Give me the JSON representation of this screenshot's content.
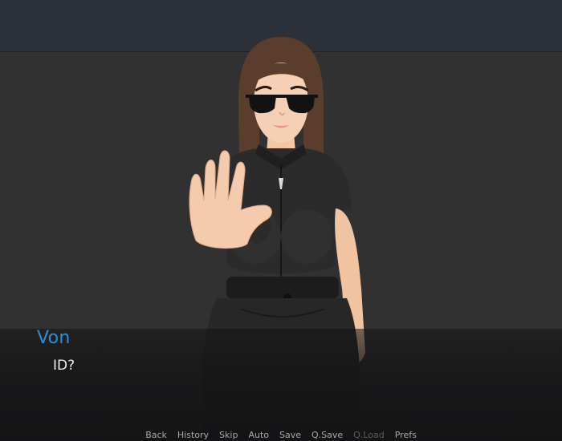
{
  "dialogue": {
    "speaker": "Von",
    "line": "ID?"
  },
  "quick_menu": {
    "items": [
      {
        "label": "Back",
        "enabled": true
      },
      {
        "label": "History",
        "enabled": true
      },
      {
        "label": "Skip",
        "enabled": true
      },
      {
        "label": "Auto",
        "enabled": true
      },
      {
        "label": "Save",
        "enabled": true
      },
      {
        "label": "Q.Save",
        "enabled": true
      },
      {
        "label": "Q.Load",
        "enabled": false
      },
      {
        "label": "Prefs",
        "enabled": true
      }
    ]
  },
  "colors": {
    "speaker": "#2f8fd0",
    "dialogue_text": "#ececec",
    "menu_enabled": "#a8a8a8",
    "menu_disabled": "#5d5d5d",
    "background": "#313131"
  }
}
